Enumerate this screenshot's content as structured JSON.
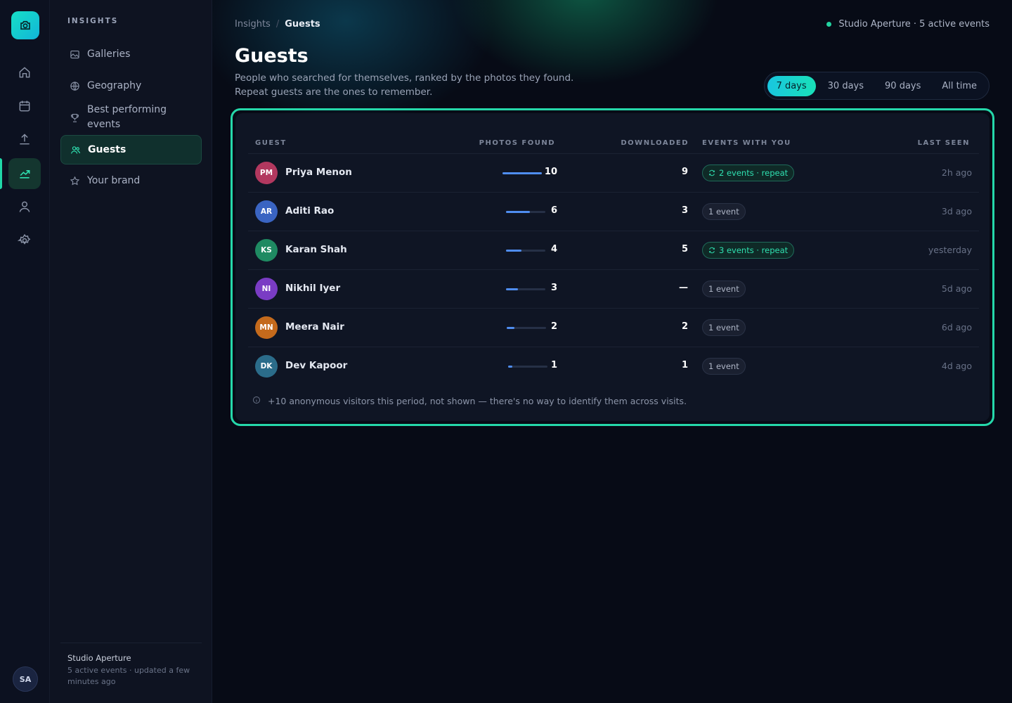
{
  "rail": {
    "items": [
      "home-icon",
      "calendar-icon",
      "upload-icon",
      "chart-icon",
      "user-icon",
      "gear-icon"
    ],
    "active": "chart-icon",
    "avatar": "SA"
  },
  "sidebar": {
    "section_title": "INSIGHTS",
    "items": [
      {
        "label": "Galleries",
        "icon": "image-icon"
      },
      {
        "label": "Geography",
        "icon": "globe-icon"
      },
      {
        "label": "Best performing events",
        "icon": "trophy-icon"
      },
      {
        "label": "Guests",
        "icon": "users-icon",
        "active": true
      },
      {
        "label": "Your brand",
        "icon": "star-icon"
      }
    ],
    "footer": {
      "name": "Studio Aperture",
      "status": "5 active events · updated a few minutes ago"
    }
  },
  "header": {
    "breadcrumb": {
      "parent": "Insights",
      "separator": "/",
      "current": "Guests"
    },
    "studio_status": "Studio Aperture · 5 active events",
    "title": "Guests",
    "subtitle": "People who searched for themselves, ranked by the photos they found. Repeat guests are the ones to remember.",
    "ranges": [
      "7 days",
      "30 days",
      "90 days",
      "All time"
    ],
    "selected_range": "7 days"
  },
  "table": {
    "columns": {
      "guest": "GUEST",
      "photos_found": "PHOTOS FOUND",
      "downloaded": "DOWNLOADED",
      "events": "EVENTS WITH YOU",
      "last_seen": "LAST SEEN"
    },
    "rows": [
      {
        "initials": "PM",
        "name": "Priya Menon",
        "photos": "10",
        "photos_fraction": 1.0,
        "downloaded": "9",
        "events": "2 events · repeat",
        "repeat": true,
        "last_seen": "2h ago",
        "color": "#b2385f"
      },
      {
        "initials": "AR",
        "name": "Aditi Rao",
        "photos": "6",
        "photos_fraction": 0.6,
        "downloaded": "3",
        "events": "1 event",
        "repeat": false,
        "last_seen": "3d ago",
        "color": "#3a64c2"
      },
      {
        "initials": "KS",
        "name": "Karan Shah",
        "photos": "4",
        "photos_fraction": 0.4,
        "downloaded": "5",
        "events": "3 events · repeat",
        "repeat": true,
        "last_seen": "yesterday",
        "color": "#1f8a62"
      },
      {
        "initials": "NI",
        "name": "Nikhil Iyer",
        "photos": "3",
        "photos_fraction": 0.3,
        "downloaded": "—",
        "events": "1 event",
        "repeat": false,
        "last_seen": "5d ago",
        "color": "#7a3cc4"
      },
      {
        "initials": "MN",
        "name": "Meera Nair",
        "photos": "2",
        "photos_fraction": 0.2,
        "downloaded": "2",
        "events": "1 event",
        "repeat": false,
        "last_seen": "6d ago",
        "color": "#c46a1c"
      },
      {
        "initials": "DK",
        "name": "Dev Kapoor",
        "photos": "1",
        "photos_fraction": 0.1,
        "downloaded": "1",
        "events": "1 event",
        "repeat": false,
        "last_seen": "4d ago",
        "color": "#2b6c8a"
      }
    ],
    "note": "+10 anonymous visitors this period, not shown — there's no way to identify them across visits."
  },
  "colors": {
    "accent": "#25d8aa",
    "bar": "#4f8df0",
    "background": "#070b16"
  }
}
